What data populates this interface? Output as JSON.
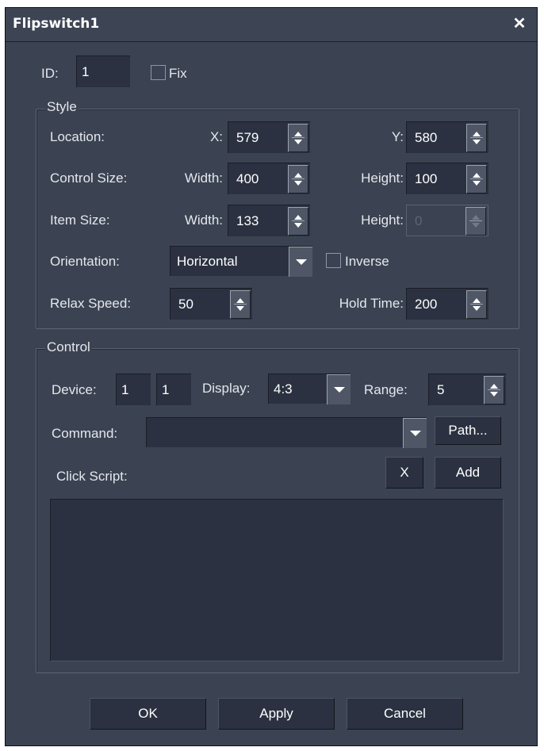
{
  "dialog": {
    "title": "Flipswitch1",
    "close_glyph": "✕"
  },
  "id_row": {
    "id_label": "ID:",
    "id_value": "1",
    "fix_label": "Fix",
    "fix_checked": false
  },
  "style": {
    "group_title": "Style",
    "location": {
      "label": "Location:",
      "x_label": "X:",
      "x_value": "579",
      "y_label": "Y:",
      "y_value": "580"
    },
    "control_size": {
      "label": "Control Size:",
      "width_label": "Width:",
      "width_value": "400",
      "height_label": "Height:",
      "height_value": "100"
    },
    "item_size": {
      "label": "Item Size:",
      "width_label": "Width:",
      "width_value": "133",
      "height_label": "Height:",
      "height_value": "0"
    },
    "orientation": {
      "label": "Orientation:",
      "value": "Horizontal",
      "inverse_label": "Inverse",
      "inverse_checked": false
    },
    "relax_speed": {
      "label": "Relax Speed:",
      "value": "50"
    },
    "hold_time": {
      "label": "Hold Time:",
      "value": "200"
    }
  },
  "control": {
    "group_title": "Control",
    "device_label": "Device:",
    "device_value_1": "1",
    "device_value_2": "1",
    "display_label": "Display:",
    "display_value": "4:3",
    "range_label": "Range:",
    "range_value": "5",
    "command_label": "Command:",
    "command_value": "",
    "path_button": "Path...",
    "click_script_label": "Click Script:",
    "clear_button": "X",
    "add_button": "Add",
    "script_text": ""
  },
  "footer": {
    "ok": "OK",
    "apply": "Apply",
    "cancel": "Cancel"
  },
  "colors": {
    "dialog_bg": "#3b4352",
    "field_bg": "#2b3140",
    "text": "#e4e7ec"
  },
  "icons": {
    "close": "close-icon",
    "spin_up": "arrow-up-icon",
    "spin_down": "arrow-down-icon",
    "dropdown": "chevron-down-icon"
  }
}
